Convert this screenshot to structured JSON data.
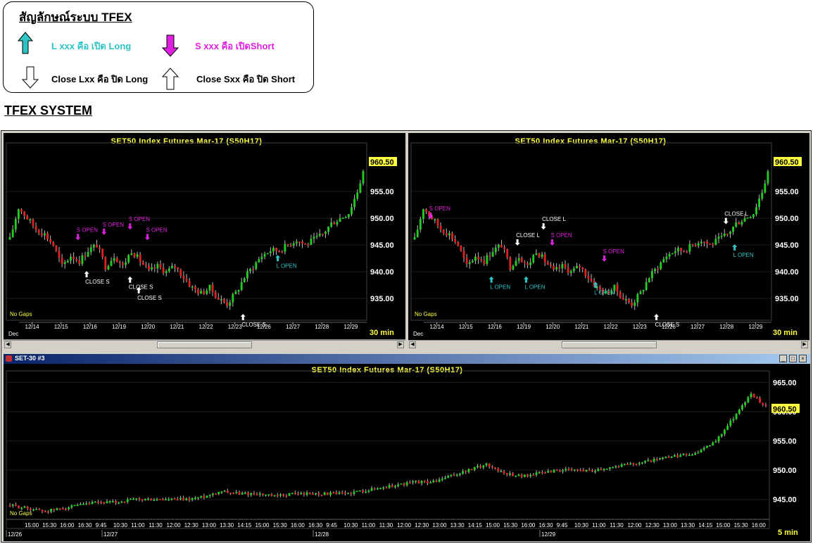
{
  "legend": {
    "title": "สัญลักษณ์ระบบ TFEX",
    "long_open": "L xxx คือ เปิด Long",
    "short_open": "S xxx คือ เปิดShort",
    "close_long": "Close Lxx คือ ปิด Long",
    "close_short": "Close Sxx คือ ปิด Short",
    "colors": {
      "long": "#2ec4c4",
      "short": "#e020e0",
      "close": "#ffffff"
    }
  },
  "section_title": "TFEX SYSTEM",
  "panels": {
    "left": {
      "title": "SET50  Index  Futures  Mar-17   (S50H17)",
      "price": "960.50",
      "no_gaps": "No  Gaps",
      "timeframe": "30  min",
      "month": "Dec"
    },
    "right": {
      "title": "SET50  Index  Futures  Mar-17   (S50H17)",
      "price": "960.50",
      "no_gaps": "No  Gaps",
      "timeframe": "30  min",
      "month": "Dec"
    },
    "bottom": {
      "window_title": "SET-30 #3",
      "title": "SET50  Index  Futures  Mar-17   (S50H17)",
      "price": "960.50",
      "no_gaps": "No  Gaps",
      "timeframe": "5  min"
    }
  },
  "chart_data": [
    {
      "type": "candlestick",
      "title": "SET50  Index  Futures  Mar-17   (S50H17)",
      "timeframe": "30 min",
      "ylim": [
        932,
        963
      ],
      "y_ticks": [
        "935.00",
        "940.00",
        "945.00",
        "950.00",
        "955.00"
      ],
      "last_price": "960.50",
      "x_ticks": [
        "12/14",
        "12/15",
        "12/16",
        "12/19",
        "12/20",
        "12/21",
        "12/22",
        "12/23",
        "12/26",
        "12/27",
        "12/28",
        "12/29"
      ],
      "close_path": [
        946,
        952,
        950,
        948,
        947,
        945,
        941,
        943,
        942,
        944,
        945,
        941,
        943,
        941,
        944,
        942,
        940,
        941,
        940,
        941,
        939,
        937,
        936,
        937,
        935,
        934,
        936,
        939,
        941,
        943,
        944,
        944,
        945,
        946,
        945,
        946,
        947,
        949,
        950,
        951,
        955,
        960.5
      ],
      "signals": [
        {
          "label": "S  OPEN",
          "kind": "short",
          "i": 8,
          "price": 946
        },
        {
          "label": "CLOSE  S",
          "kind": "close_short",
          "i": 9,
          "price": 940
        },
        {
          "label": "S  OPEN",
          "kind": "short",
          "i": 11,
          "price": 947
        },
        {
          "label": "S  OPEN",
          "kind": "short",
          "i": 14,
          "price": 948
        },
        {
          "label": "CLOSE  S",
          "kind": "close_short",
          "i": 14,
          "price": 939
        },
        {
          "label": "S  OPEN",
          "kind": "short",
          "i": 16,
          "price": 946
        },
        {
          "label": "CLOSE  S",
          "kind": "close_short",
          "i": 15,
          "price": 937
        },
        {
          "label": "CLOSE  S",
          "kind": "close_short",
          "i": 27,
          "price": 932
        },
        {
          "label": "L  OPEN",
          "kind": "long",
          "i": 31,
          "price": 943
        }
      ]
    },
    {
      "type": "candlestick",
      "title": "SET50  Index  Futures  Mar-17   (S50H17)",
      "timeframe": "30 min",
      "ylim": [
        932,
        963
      ],
      "y_ticks": [
        "935.00",
        "940.00",
        "945.00",
        "950.00",
        "955.00"
      ],
      "last_price": "960.50",
      "x_ticks": [
        "12/14",
        "12/15",
        "12/16",
        "12/19",
        "12/20",
        "12/21",
        "12/22",
        "12/23",
        "12/26",
        "12/27",
        "12/28",
        "12/29"
      ],
      "close_path": [
        946,
        952,
        950,
        948,
        947,
        945,
        941,
        943,
        942,
        944,
        945,
        941,
        943,
        941,
        944,
        942,
        940,
        941,
        940,
        941,
        939,
        937,
        936,
        937,
        935,
        934,
        936,
        939,
        941,
        943,
        944,
        944,
        945,
        946,
        945,
        946,
        947,
        949,
        950,
        951,
        955,
        960.5
      ],
      "signals": [
        {
          "label": "S  OPEN",
          "kind": "short",
          "i": 2,
          "price": 950
        },
        {
          "label": "L  OPEN",
          "kind": "long",
          "i": 9,
          "price": 939
        },
        {
          "label": "CLOSE  L",
          "kind": "close_long",
          "i": 12,
          "price": 945
        },
        {
          "label": "L  OPEN",
          "kind": "long",
          "i": 13,
          "price": 939
        },
        {
          "label": "CLOSE  L",
          "kind": "close_long",
          "i": 15,
          "price": 948
        },
        {
          "label": "S  OPEN",
          "kind": "short",
          "i": 16,
          "price": 945
        },
        {
          "label": "L  OPEN",
          "kind": "long",
          "i": 21,
          "price": 938
        },
        {
          "label": "S  OPEN",
          "kind": "short",
          "i": 22,
          "price": 942
        },
        {
          "label": "CLOSE  S",
          "kind": "close_short",
          "i": 28,
          "price": 932
        },
        {
          "label": "CLOSE  L",
          "kind": "close_long",
          "i": 36,
          "price": 949
        },
        {
          "label": "L  OPEN",
          "kind": "long",
          "i": 37,
          "price": 945
        }
      ]
    },
    {
      "type": "candlestick",
      "title": "SET50  Index  Futures  Mar-17   (S50H17)",
      "timeframe": "5 min",
      "ylim": [
        941,
        966
      ],
      "y_ticks": [
        "945.00",
        "950.00",
        "955.00",
        "960.00",
        "965.00"
      ],
      "last_price": "960.50",
      "x_ticks": [
        "15:00",
        "15:30",
        "16:00",
        "16:30",
        "9:45",
        "10:30",
        "11:00",
        "11:30",
        "12:00",
        "12:30",
        "13:00",
        "13:30",
        "14:15",
        "15:00",
        "15:30",
        "16:00",
        "16:30",
        "9:45",
        "10:30",
        "11:00",
        "11:30",
        "12:00",
        "12:30",
        "13:00",
        "13:30",
        "14:15",
        "15:00",
        "15:30",
        "16:00",
        "16:30",
        "9:45",
        "10:30",
        "11:00",
        "11:30",
        "12:00",
        "12:30",
        "13:00",
        "13:30",
        "14:15",
        "15:00",
        "15:30",
        "16:00"
      ],
      "date_labels": [
        "12/26",
        "12/27",
        "12/28",
        "12/29"
      ],
      "close_path": [
        944,
        943.5,
        943,
        943.5,
        944,
        944.5,
        944.5,
        945,
        945,
        945,
        945,
        945.5,
        946.5,
        946,
        946,
        945.5,
        946,
        946,
        946,
        946,
        946.5,
        947,
        947.5,
        948,
        948,
        949,
        950,
        951,
        949.5,
        949,
        949.5,
        950,
        950,
        950,
        950.5,
        951,
        951.5,
        952,
        952.5,
        953,
        955,
        959,
        963,
        960.5
      ]
    }
  ]
}
